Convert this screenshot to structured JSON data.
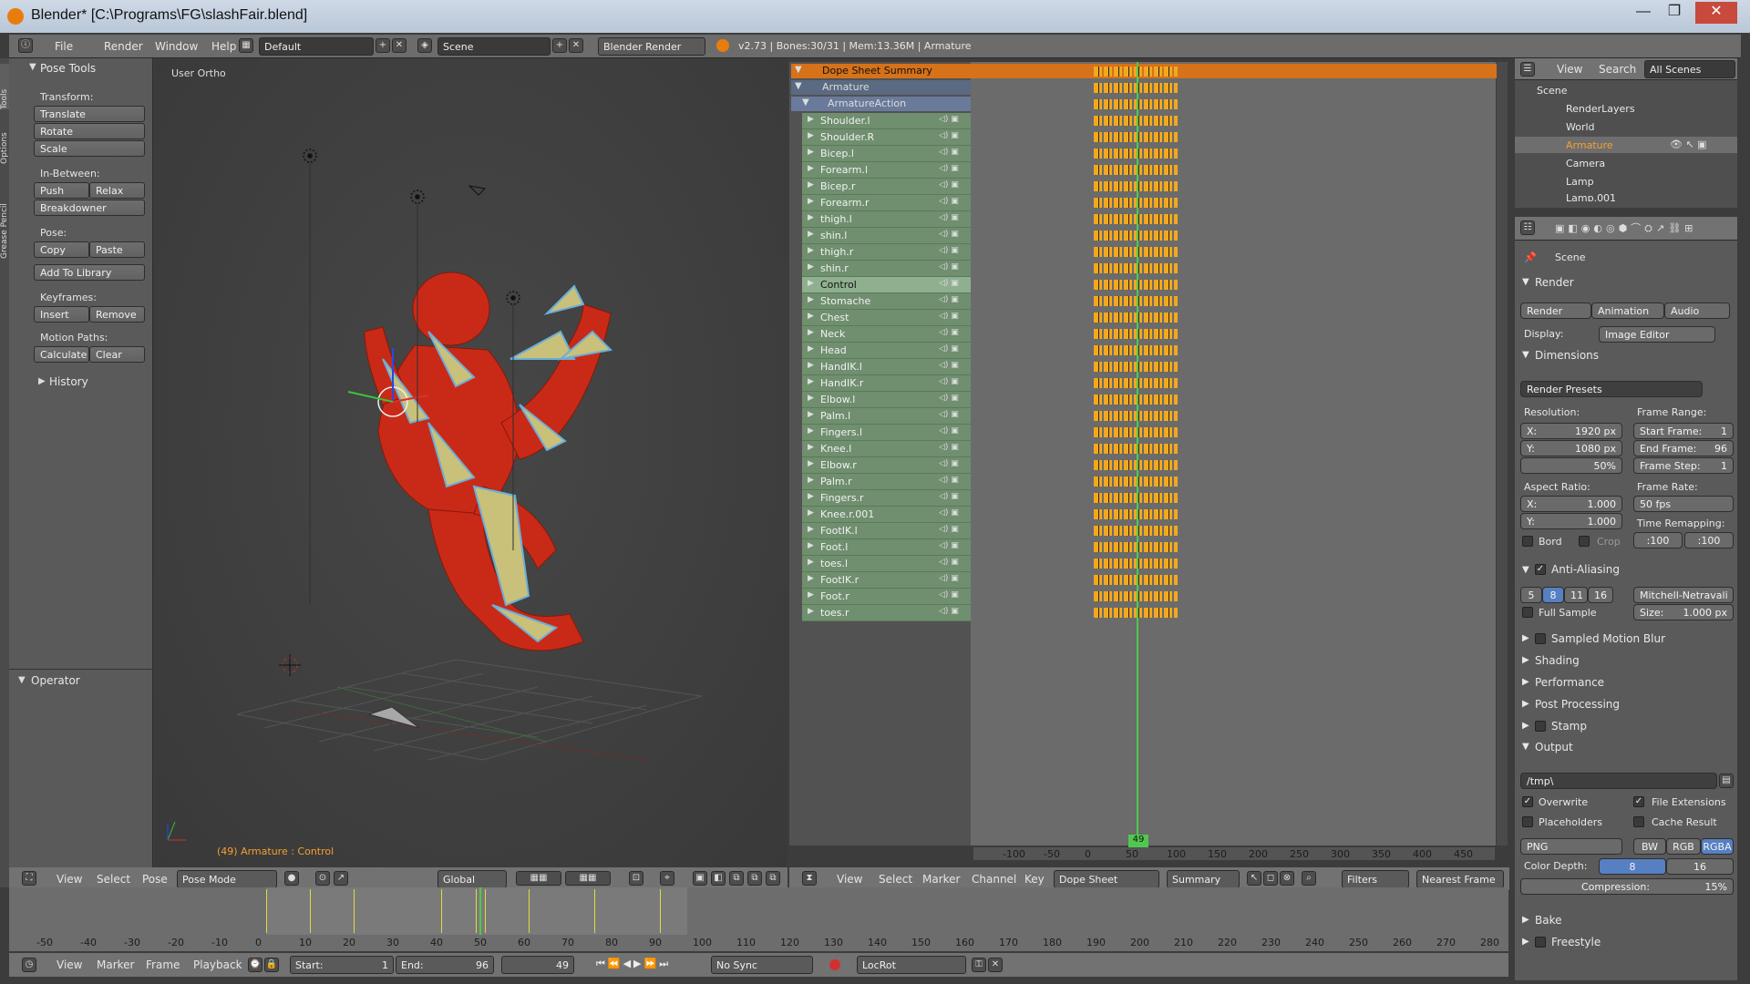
{
  "window": {
    "title": "Blender* [C:\\Programs\\FG\\slashFair.blend]"
  },
  "info_header": {
    "menus": [
      "File",
      "Render",
      "Window",
      "Help"
    ],
    "screen_layout": "Default",
    "scene": "Scene",
    "engine": "Blender Render",
    "stats": "v2.73 | Bones:30/31 | Mem:13.36M | Armature"
  },
  "tool_shelf": {
    "tabs": [
      "Tools",
      "Options",
      "Grease Pencil"
    ],
    "panel_title": "Pose Tools",
    "transform_label": "Transform:",
    "translate": "Translate",
    "rotate": "Rotate",
    "scale": "Scale",
    "inbetween_label": "In-Between:",
    "push": "Push",
    "relax": "Relax",
    "breakdowner": "Breakdowner",
    "pose_label": "Pose:",
    "copy": "Copy",
    "paste": "Paste",
    "add_to_library": "Add To Library",
    "keyframes_label": "Keyframes:",
    "insert": "Insert",
    "remove": "Remove",
    "motion_paths_label": "Motion Paths:",
    "calculate": "Calculate",
    "clear": "Clear",
    "history": "History",
    "operator": "Operator"
  },
  "viewport": {
    "view_name": "User Ortho",
    "status": "(49) Armature : Control",
    "header_menus": [
      "View",
      "Select",
      "Pose"
    ],
    "mode": "Pose Mode",
    "orientation": "Global"
  },
  "dopesheet": {
    "summary": "Dope Sheet Summary",
    "object": "Armature",
    "action": "ArmatureAction",
    "channels": [
      "Shoulder.l",
      "Shoulder.R",
      "Bicep.l",
      "Forearm.l",
      "Bicep.r",
      "Forearm.r",
      "thigh.l",
      "shin.l",
      "thigh.r",
      "shin.r",
      "Control",
      "Stomache",
      "Chest",
      "Neck",
      "Head",
      "HandIK.l",
      "HandIK.r",
      "Elbow.l",
      "Palm.l",
      "Fingers.l",
      "Knee.l",
      "Elbow.r",
      "Palm.r",
      "Fingers.r",
      "Knee.r.001",
      "FootIK.l",
      "Foot.l",
      "toes.l",
      "FootIK.r",
      "Foot.r",
      "toes.r"
    ],
    "current_frame": "49",
    "ruler": [
      "-100",
      "-50",
      "0",
      "50",
      "100",
      "150",
      "200",
      "250",
      "300",
      "350",
      "400",
      "450"
    ],
    "header_menus": [
      "View",
      "Select",
      "Marker",
      "Channel",
      "Key"
    ],
    "mode": "Dope Sheet",
    "summary_toggle": "Summary",
    "filters": "Filters",
    "snap": "Nearest Frame"
  },
  "outliner": {
    "menus": [
      "View",
      "Search"
    ],
    "scenes": "All Scenes",
    "items": [
      "Scene",
      "RenderLayers",
      "World",
      "Armature",
      "Camera",
      "Lamp",
      "Lamp.001"
    ]
  },
  "properties": {
    "breadcrumb": "Scene",
    "render_panel": "Render",
    "render_btn": "Render",
    "animation_btn": "Animation",
    "audio_btn": "Audio",
    "display_label": "Display:",
    "display_value": "Image Editor",
    "dimensions_panel": "Dimensions",
    "render_presets": "Render Presets",
    "resolution_label": "Resolution:",
    "res_x": "X:",
    "res_x_val": "1920 px",
    "res_y": "Y:",
    "res_y_val": "1080 px",
    "res_pct": "50%",
    "frame_range_label": "Frame Range:",
    "start_frame": "Start Frame:",
    "start_val": "1",
    "end_frame": "End Frame:",
    "end_val": "96",
    "frame_step": "Frame Step:",
    "step_val": "1",
    "aspect_label": "Aspect Ratio:",
    "asp_x": "X:",
    "asp_x_val": "1.000",
    "asp_y": "Y:",
    "asp_y_val": "1.000",
    "frame_rate_label": "Frame Rate:",
    "frame_rate": "50 fps",
    "time_remap_label": "Time Remapping:",
    "remap_old": ":100",
    "remap_new": ":100",
    "bord": "Bord",
    "crop": "Crop",
    "aa_panel": "Anti-Aliasing",
    "aa_samples": [
      "5",
      "8",
      "11",
      "16"
    ],
    "aa_filter": "Mitchell-Netravali",
    "full_sample": "Full Sample",
    "size_label": "Size:",
    "size_val": "1.000 px",
    "panels": [
      "Sampled Motion Blur",
      "Shading",
      "Performance",
      "Post Processing",
      "Stamp"
    ],
    "output_panel": "Output",
    "output_path": "/tmp\\",
    "overwrite": "Overwrite",
    "file_ext": "File Extensions",
    "placeholders": "Placeholders",
    "cache_result": "Cache Result",
    "format": "PNG",
    "bw": "BW",
    "rgb": "RGB",
    "rgba": "RGBA",
    "color_depth": "Color Depth:",
    "depth_8": "8",
    "depth_16": "16",
    "compression": "Compression:",
    "compression_val": "15%",
    "bake": "Bake",
    "freestyle": "Freestyle"
  },
  "timeline": {
    "ticks": [
      "-50",
      "-40",
      "-30",
      "-20",
      "-10",
      "0",
      "10",
      "20",
      "30",
      "40",
      "50",
      "60",
      "70",
      "80",
      "90",
      "100",
      "110",
      "120",
      "130",
      "140",
      "150",
      "160",
      "170",
      "180",
      "190",
      "200",
      "210",
      "220",
      "230",
      "240",
      "250",
      "260",
      "270",
      "280"
    ],
    "menus": [
      "View",
      "Marker",
      "Frame",
      "Playback"
    ],
    "start_label": "Start:",
    "start": "1",
    "end_label": "End:",
    "end": "96",
    "current": "49",
    "sync": "No Sync",
    "keying_set": "LocRot"
  },
  "colors": {
    "accent": "#f1a820",
    "selected_bg": "#5680c2",
    "channel_green": "#6f8f6f",
    "frame_line": "#50c850"
  }
}
